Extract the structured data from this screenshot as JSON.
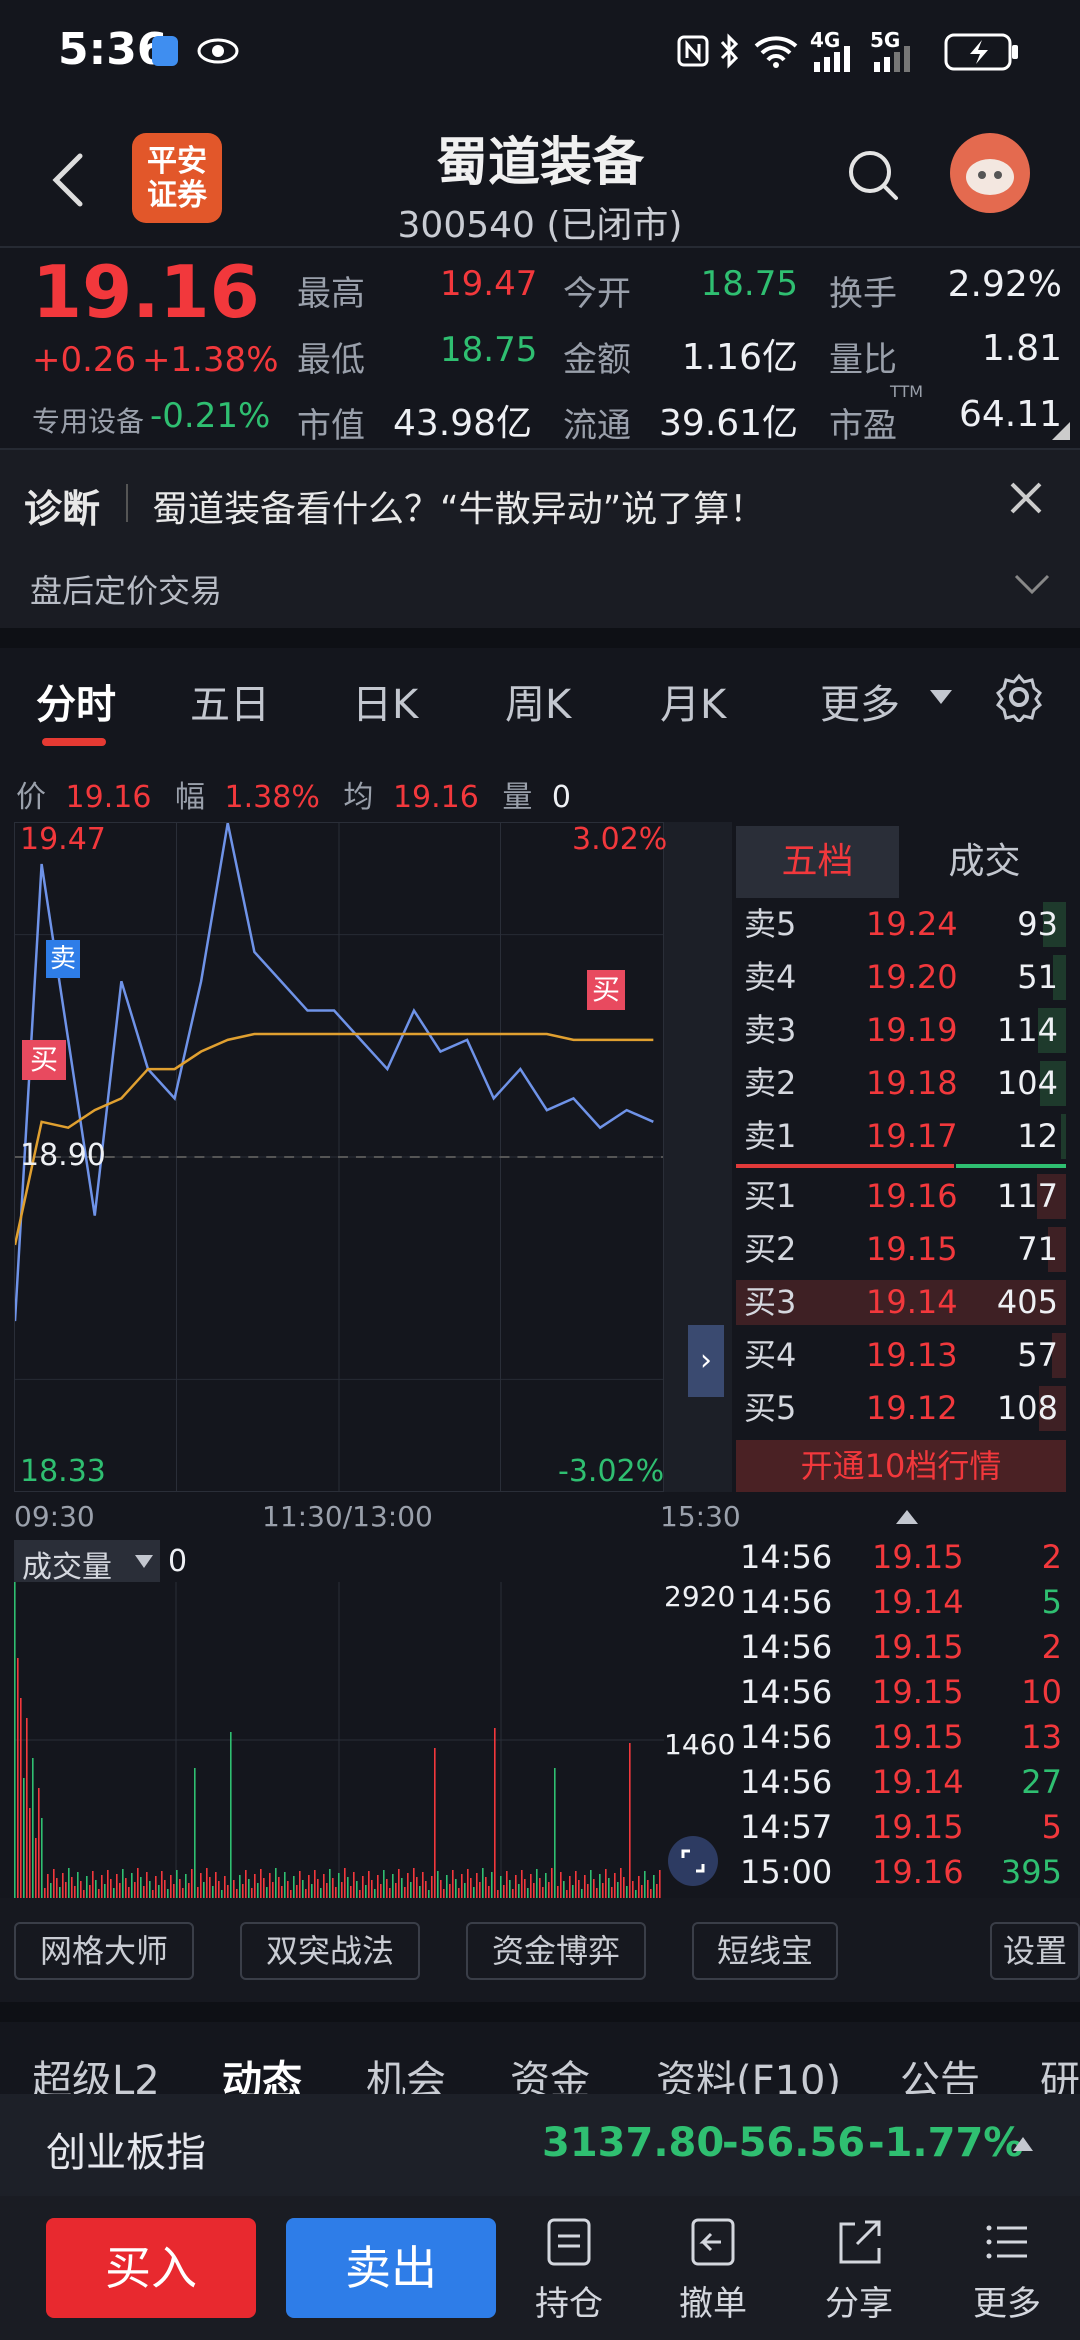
{
  "status": {
    "time": "5:36",
    "network": "4G",
    "network2": "5G"
  },
  "header": {
    "stock_name": "蜀道装备",
    "code_status": "300540 (已闭市)",
    "broker_logo_text": [
      "平安",
      "证券"
    ]
  },
  "quote": {
    "price": "19.16",
    "change": "+0.26",
    "change_pct": "+1.38%",
    "sector_label": "专用设备",
    "sector_change": "-0.21%",
    "high_label": "最高",
    "high": "19.47",
    "low_label": "最低",
    "low": "18.75",
    "mktcap_label": "市值",
    "mktcap": "43.98亿",
    "open_label": "今开",
    "open": "18.75",
    "amount_label": "金额",
    "amount": "1.16亿",
    "float_label": "流通",
    "float": "39.61亿",
    "turnover_label": "换手",
    "turnover": "2.92%",
    "vol_ratio_label": "量比",
    "vol_ratio": "1.81",
    "pe_label": "市盈",
    "pe_sup": "TTM",
    "pe": "64.11"
  },
  "banner": {
    "tag": "诊断",
    "text": "蜀道装备看什么？“牛散异动”说了算！",
    "after_hours": "盘后定价交易"
  },
  "tabs": [
    "分时",
    "五日",
    "日K",
    "周K",
    "月K",
    "更多"
  ],
  "info_line": {
    "price_label": "价",
    "price": "19.16",
    "range_label": "幅",
    "range": "1.38%",
    "avg_label": "均",
    "avg": "19.16",
    "vol_label": "量",
    "vol": "0"
  },
  "chart_labels": {
    "top_price": "19.47",
    "top_pct": "3.02%",
    "mid_price": "18.90",
    "bottom_price": "18.33",
    "bottom_pct": "-3.02%",
    "t_start": "09:30",
    "t_mid": "11:30/13:00",
    "t_end": "15:30",
    "sell_marker": "卖",
    "buy_marker": "买",
    "buy_marker2": "买"
  },
  "chart_data": {
    "type": "line",
    "ylim": [
      18.33,
      19.47
    ],
    "x": [
      "09:30",
      "11:30/13:00",
      "15:30"
    ],
    "series": [
      {
        "values": [
          18.62,
          19.4,
          19.1,
          18.8,
          19.2,
          19.05,
          19.0,
          19.2,
          19.47,
          19.25,
          19.2,
          19.15,
          19.15,
          19.1,
          19.05,
          19.15,
          19.08,
          19.1,
          19.0,
          19.05,
          18.98,
          19.0,
          18.95,
          18.98,
          18.96
        ]
      },
      {
        "values": [
          18.75,
          18.96,
          18.95,
          18.98,
          19.0,
          19.05,
          19.05,
          19.08,
          19.1,
          19.11,
          19.11,
          19.11,
          19.11,
          19.11,
          19.11,
          19.11,
          19.11,
          19.11,
          19.11,
          19.11,
          19.11,
          19.1,
          19.1,
          19.1,
          19.1
        ]
      }
    ],
    "volume": {
      "label": "成交量",
      "value": "0",
      "max_label": "2920",
      "mid_label": "1460"
    }
  },
  "orderbook": {
    "tabs": [
      "五档",
      "成交"
    ],
    "asks": [
      {
        "label": "卖5",
        "price": "19.24",
        "vol": "93",
        "w": 0.23
      },
      {
        "label": "卖4",
        "price": "19.20",
        "vol": "51",
        "w": 0.13
      },
      {
        "label": "卖3",
        "price": "19.19",
        "vol": "114",
        "w": 0.28
      },
      {
        "label": "卖2",
        "price": "19.18",
        "vol": "104",
        "w": 0.26
      },
      {
        "label": "卖1",
        "price": "19.17",
        "vol": "12",
        "w": 0.03
      }
    ],
    "bids": [
      {
        "label": "买1",
        "price": "19.16",
        "vol": "117",
        "w": 0.29
      },
      {
        "label": "买2",
        "price": "19.15",
        "vol": "71",
        "w": 0.18
      },
      {
        "label": "买3",
        "price": "19.14",
        "vol": "405",
        "w": 1.0
      },
      {
        "label": "买4",
        "price": "19.13",
        "vol": "57",
        "w": 0.14
      },
      {
        "label": "买5",
        "price": "19.12",
        "vol": "108",
        "w": 0.27
      }
    ],
    "open_level10": "开通10档行情"
  },
  "ticks": [
    {
      "t": "14:56",
      "p": "19.15",
      "v": "2",
      "c": "red"
    },
    {
      "t": "14:56",
      "p": "19.14",
      "v": "5",
      "c": "green"
    },
    {
      "t": "14:56",
      "p": "19.15",
      "v": "2",
      "c": "red"
    },
    {
      "t": "14:56",
      "p": "19.15",
      "v": "10",
      "c": "red"
    },
    {
      "t": "14:56",
      "p": "19.15",
      "v": "13",
      "c": "red"
    },
    {
      "t": "14:56",
      "p": "19.14",
      "v": "27",
      "c": "green"
    },
    {
      "t": "14:57",
      "p": "19.15",
      "v": "5",
      "c": "red"
    },
    {
      "t": "15:00",
      "p": "19.16",
      "v": "395",
      "c": "green"
    }
  ],
  "tools": [
    "网格大师",
    "双突战法",
    "资金博弈",
    "短线宝",
    "设置"
  ],
  "bottom_tabs": [
    "超级L2",
    "动态",
    "机会",
    "资金",
    "资料(F10)",
    "公告",
    "研"
  ],
  "index": {
    "name": "创业板指",
    "value": "3137.80",
    "change": "-56.56",
    "pct": "-1.77%"
  },
  "actions": {
    "buy": "买入",
    "sell": "卖出",
    "hold": "持仓",
    "cancel": "撤单",
    "share": "分享",
    "more": "更多"
  },
  "colors": {
    "up": "#f2383c",
    "down": "#2fbf71",
    "bg": "#14161d",
    "accent": "#e63a33",
    "sell_btn": "#2e7de8"
  }
}
